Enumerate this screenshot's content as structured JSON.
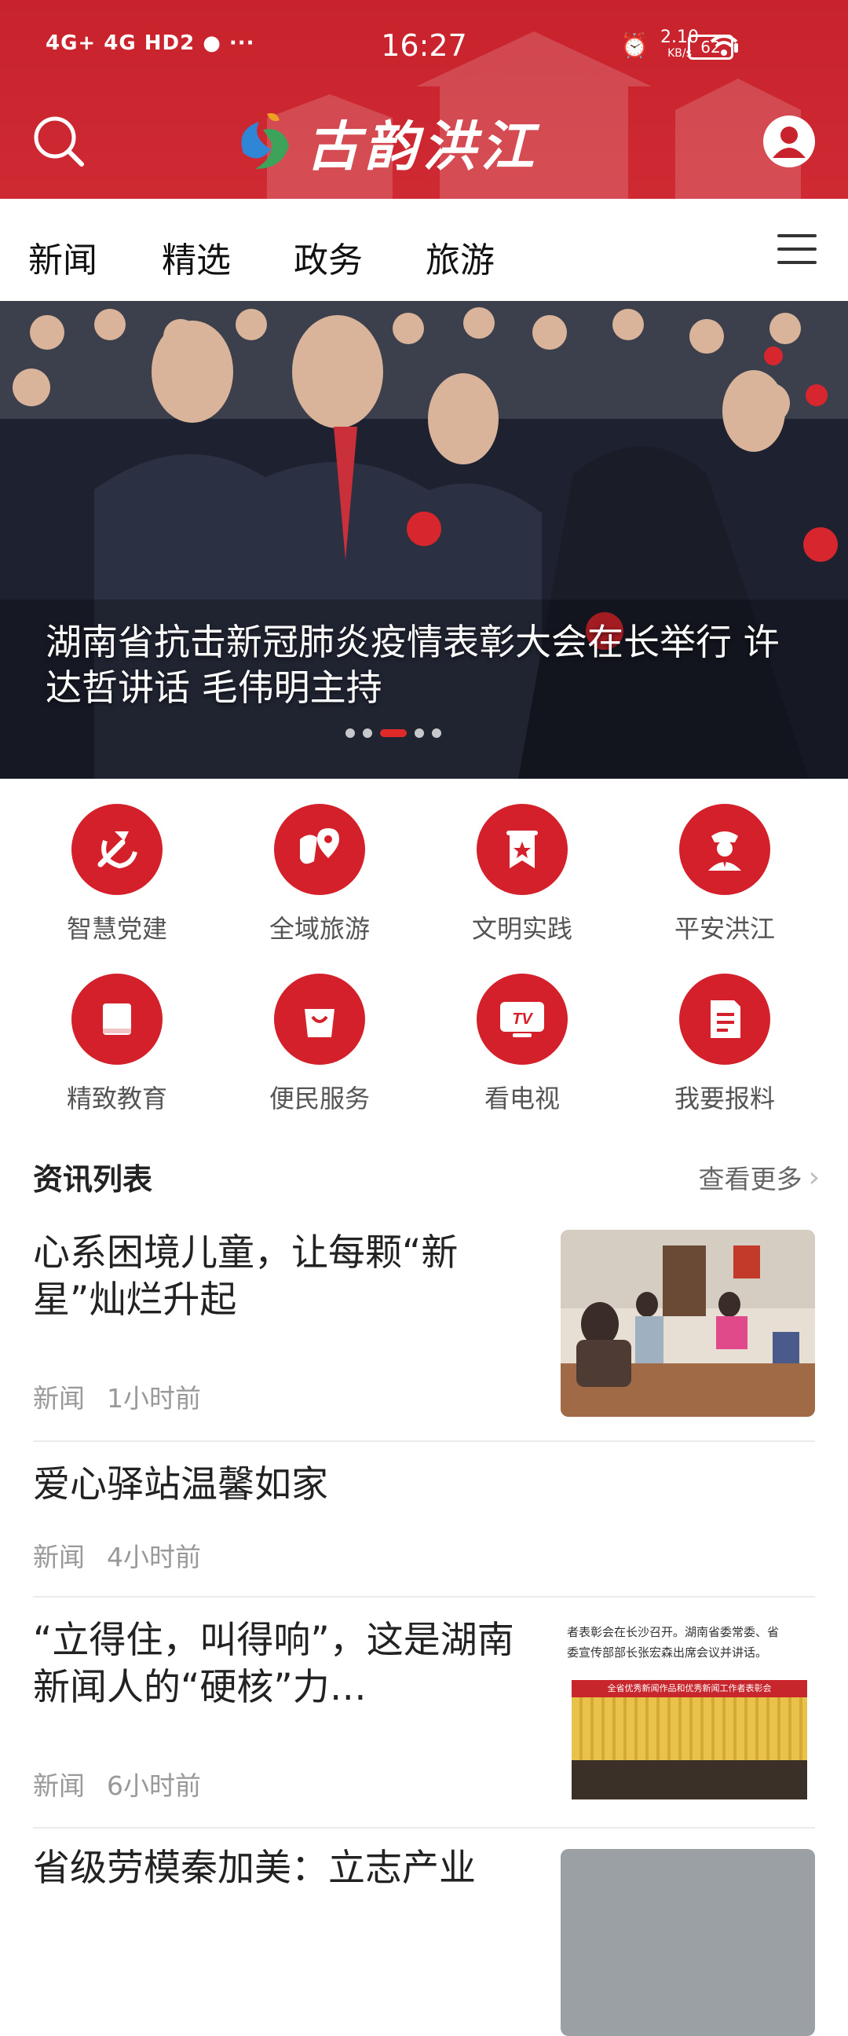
{
  "status_bar": {
    "network": "4G+ 4G HD2",
    "time": "16:27",
    "speed": "2.10",
    "speed_unit": "KB/s",
    "battery": "62"
  },
  "app": {
    "title": "古韵洪江",
    "brand_color": "#c8232d"
  },
  "tabs": [
    {
      "label": "新闻"
    },
    {
      "label": "精选"
    },
    {
      "label": "政务"
    },
    {
      "label": "旅游"
    }
  ],
  "banner": {
    "caption": "湖南省抗击新冠肺炎疫情表彰大会在长举行 许达哲讲话 毛伟明主持",
    "slides": 5,
    "active_slide": 3
  },
  "services": [
    {
      "label": "智慧党建",
      "icon": "hammer-sickle-icon"
    },
    {
      "label": "全域旅游",
      "icon": "map-pin-icon"
    },
    {
      "label": "文明实践",
      "icon": "banner-star-icon"
    },
    {
      "label": "平安洪江",
      "icon": "police-icon"
    },
    {
      "label": "精致教育",
      "icon": "book-icon"
    },
    {
      "label": "便民服务",
      "icon": "shopping-bag-icon"
    },
    {
      "label": "看电视",
      "icon": "tv-icon"
    },
    {
      "label": "我要报料",
      "icon": "report-icon"
    }
  ],
  "news_section": {
    "title": "资讯列表",
    "more_label": "查看更多"
  },
  "news": [
    {
      "title": "心系困境儿童，让每颗“新星”灿烂升起",
      "category": "新闻",
      "time": "1小时前"
    },
    {
      "title": "爱心驿站温馨如家",
      "category": "新闻",
      "time": "4小时前"
    },
    {
      "title": "“立得住，叫得响”，这是湖南新闻人的“硬核”力…",
      "category": "新闻",
      "time": "6小时前",
      "thumb_text_1": "者表彰会在长沙召开。湖南省委常委、省",
      "thumb_text_2": "委宣传部部长张宏森出席会议并讲话。",
      "thumb_banner": "全省优秀新闻作品和优秀新闻工作者表彰会"
    },
    {
      "title": "省级劳模秦加美：立志产业"
    }
  ]
}
